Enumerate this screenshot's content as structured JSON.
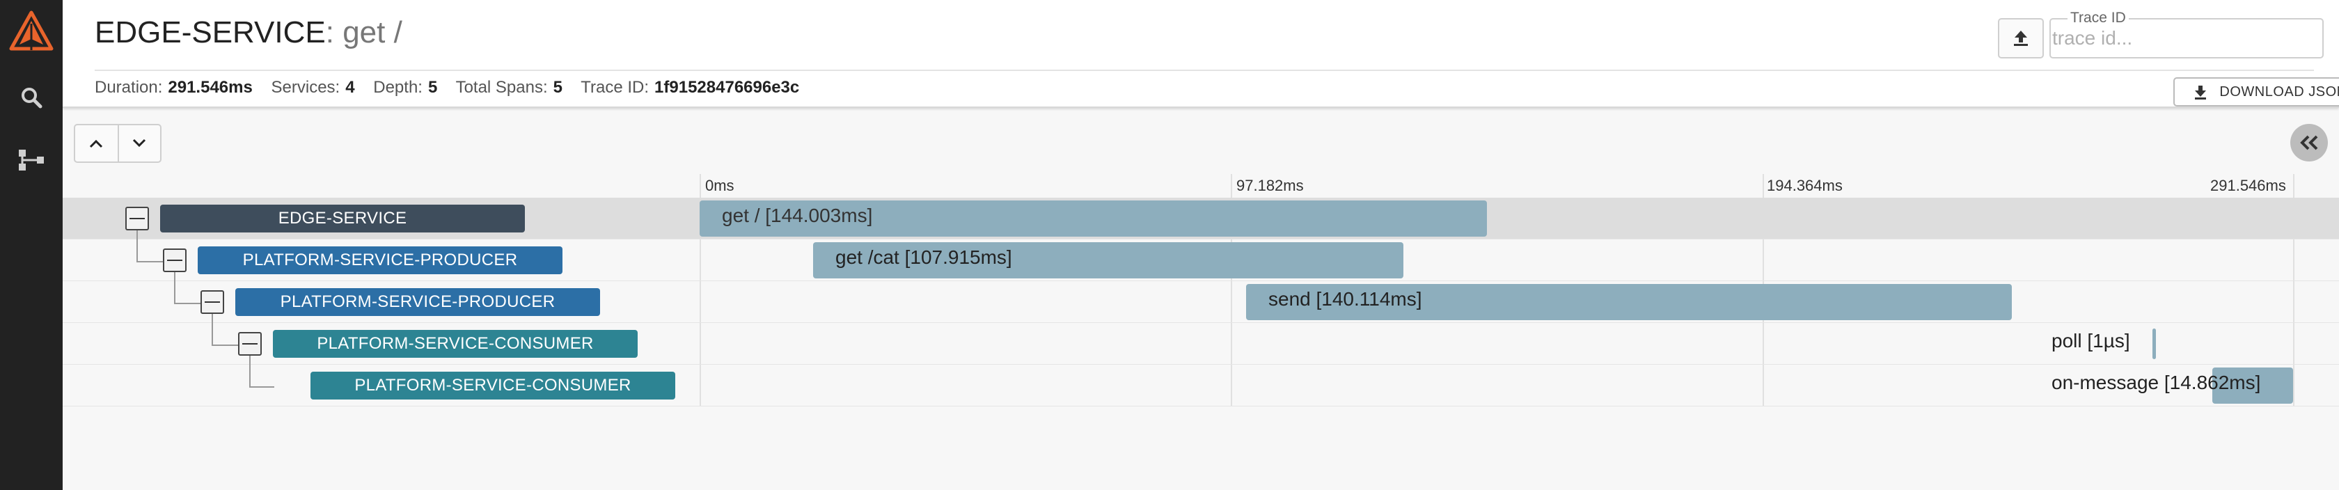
{
  "nav": {
    "items": [
      "logo-icon",
      "search-icon",
      "dependency-graph-icon"
    ],
    "accent": "#e8642c"
  },
  "header": {
    "service": "EDGE-SERVICE",
    "separator": ":",
    "operation": "get /",
    "trace_id_legend": "Trace ID",
    "trace_id_placeholder": "trace id...",
    "download_label": "DOWNLOAD JSON"
  },
  "stats": [
    {
      "label": "Duration:",
      "value": "291.546ms"
    },
    {
      "label": "Services:",
      "value": "4"
    },
    {
      "label": "Depth:",
      "value": "5"
    },
    {
      "label": "Total Spans:",
      "value": "5"
    },
    {
      "label": "Trace ID:",
      "value": "1f91528476696e3c"
    }
  ],
  "timeline": {
    "ticks": [
      "0ms",
      "97.182ms",
      "194.364ms",
      "291.546ms"
    ],
    "total_ms": 291.546
  },
  "spans": [
    {
      "service": "EDGE-SERVICE",
      "operation": "get /",
      "label": "get / [144.003ms]",
      "start_ms": 0,
      "duration_ms": 144.003,
      "color": "#3e4d5c",
      "selected": true
    },
    {
      "service": "PLATFORM-SERVICE-PRODUCER",
      "operation": "get /cat",
      "label": "get /cat [107.915ms]",
      "start_ms": 20.8,
      "duration_ms": 107.915,
      "color": "#2c6fa6",
      "selected": false
    },
    {
      "service": "PLATFORM-SERVICE-PRODUCER",
      "operation": "send",
      "label": "send [140.114ms]",
      "start_ms": 99.8,
      "duration_ms": 140.114,
      "color": "#2c6fa6",
      "selected": false
    },
    {
      "service": "PLATFORM-SERVICE-CONSUMER",
      "operation": "poll",
      "label": "poll [1µs]",
      "start_ms": 264.2,
      "duration_ms": 0.001,
      "color": "#2d8493",
      "selected": false
    },
    {
      "service": "PLATFORM-SERVICE-CONSUMER",
      "operation": "on-message",
      "label": "on-message [14.862ms]",
      "start_ms": 276.6,
      "duration_ms": 14.862,
      "color": "#2d8493",
      "selected": false
    }
  ]
}
